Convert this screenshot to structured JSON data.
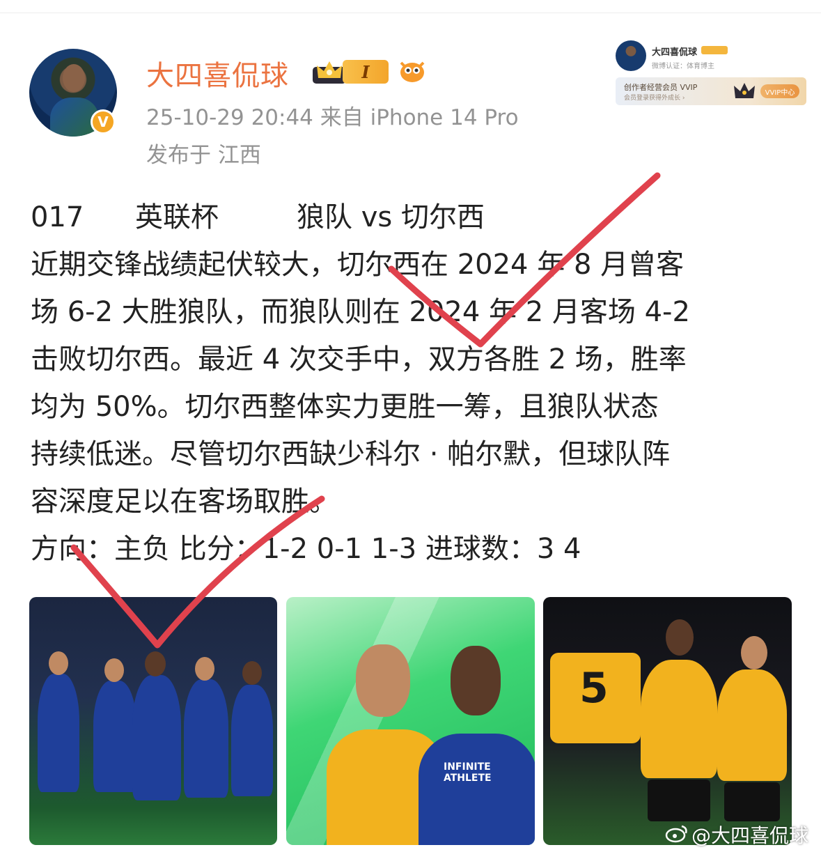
{
  "post": {
    "username": "大四喜侃球",
    "level_badge": "I",
    "meta": "25-10-29 20:44  来自 iPhone 14 Pro",
    "location": "发布于 江西",
    "header": {
      "code": "017",
      "competition": "英联杯",
      "match": "狼队 vs 切尔西"
    },
    "body_lines": [
      "近期交锋战绩起伏较大，切尔西在 2024 年 8 月曾客",
      "场 6-2 大胜狼队，而狼队则在 2024 年 2 月客场 4-2",
      "击败切尔西。最近 4 次交手中，双方各胜 2 场，胜率",
      "均为 50%。切尔西整体实力更胜一筹，且狼队状态",
      "持续低迷。尽管切尔西缺少科尔 · 帕尔默，但球队阵",
      "容深度足以在客场取胜。"
    ],
    "prediction": "方向：主负 比分：1-2  0-1  1-3 进球数：3  4"
  },
  "mini_card": {
    "name": "大四喜侃球",
    "subtitle": "微博认证：体育博主",
    "vvip_title": "创作者经营会员 VVIP",
    "vvip_sub": "会员登录获得外成长 ›",
    "vvip_button": "VVIP中心"
  },
  "watermark": "@大四喜侃球",
  "colors": {
    "username": "#eb7340",
    "tick": "#e0424d",
    "meta": "#939393"
  }
}
